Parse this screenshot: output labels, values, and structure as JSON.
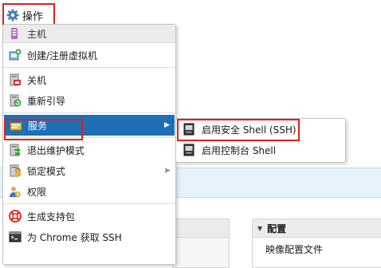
{
  "actions": {
    "label": "操作"
  },
  "menu": {
    "header": "主机",
    "items": {
      "create_vm": "创建/注册虚拟机",
      "shutdown": "关机",
      "reboot": "重新引导",
      "services": "服务",
      "exit_maintenance": "退出维护模式",
      "lockdown": "锁定模式",
      "permissions": "权限",
      "support_bundle": "生成支持包",
      "chrome_ssh": "为 Chrome 获取 SSH"
    }
  },
  "submenu": {
    "enable_ssh": "启用安全 Shell (SSH)",
    "enable_console": "启用控制台 Shell"
  },
  "background": {
    "config_header": "配置",
    "image_profile": "映像配置文件"
  },
  "colors": {
    "highlight": "#1f6fb6",
    "annotation": "#e02020"
  }
}
